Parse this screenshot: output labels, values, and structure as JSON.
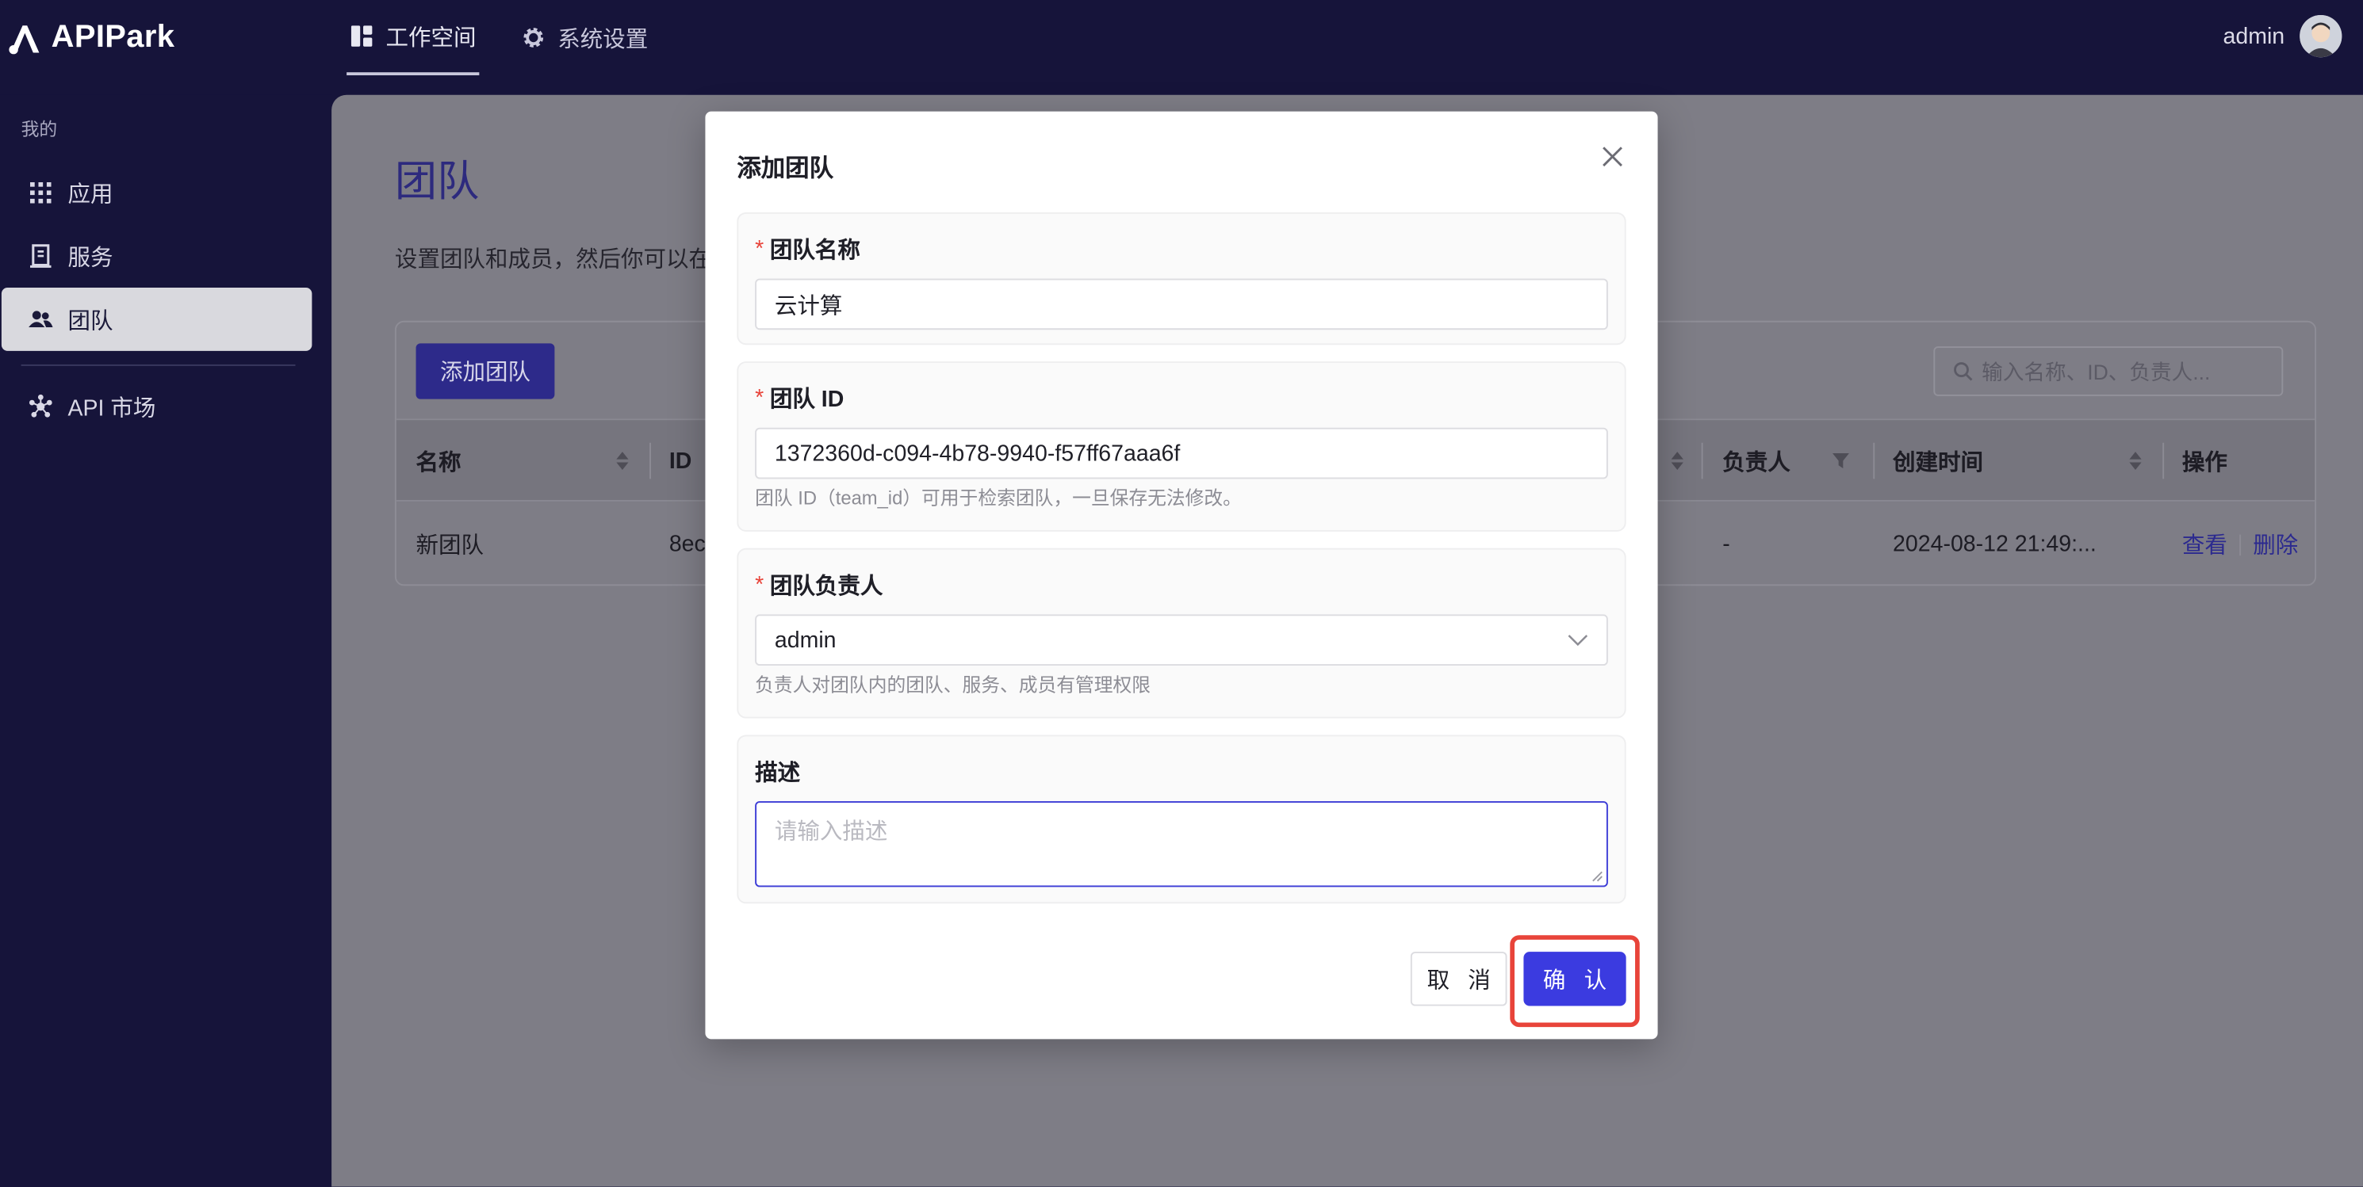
{
  "brand": {
    "name": "APIPark"
  },
  "nav": {
    "items": [
      {
        "label": "工作空间",
        "icon": "dashboard-icon",
        "active": true
      },
      {
        "label": "系统设置",
        "icon": "gear-icon",
        "active": false
      }
    ]
  },
  "user": {
    "name": "admin",
    "avatar": "avatar-icon"
  },
  "sidebar": {
    "section": "我的",
    "items": [
      {
        "label": "应用",
        "icon": "grid-icon"
      },
      {
        "label": "服务",
        "icon": "building-icon"
      },
      {
        "label": "团队",
        "icon": "team-icon",
        "active": true
      },
      {
        "label": "API 市场",
        "icon": "network-icon"
      }
    ]
  },
  "page": {
    "title": "团队",
    "description": "设置团队和成员，然后你可以在",
    "add_button": "添加团队",
    "search_placeholder": "输入名称、ID、负责人...",
    "table": {
      "columns": [
        "名称",
        "ID",
        "负责人",
        "创建时间",
        "操作"
      ],
      "rows": [
        {
          "name": "新团队",
          "id": "8ec",
          "owner": "-",
          "created": "2024-08-12 21:49:...",
          "actions": [
            "查看",
            "删除"
          ]
        }
      ]
    }
  },
  "modal": {
    "title": "添加团队",
    "fields": {
      "name": {
        "label": "团队名称",
        "value": "云计算"
      },
      "id": {
        "label": "团队 ID",
        "value": "1372360d-c094-4b78-9940-f57ff67aaa6f",
        "hint": "团队 ID（team_id）可用于检索团队，一旦保存无法修改。"
      },
      "owner": {
        "label": "团队负责人",
        "value": "admin",
        "hint": "负责人对团队内的团队、服务、成员有管理权限"
      },
      "description": {
        "label": "描述",
        "placeholder": "请输入描述"
      }
    },
    "cancel_label": "取 消",
    "confirm_label": "确 认"
  },
  "colors": {
    "background": "#16143a",
    "primary": "#3b3be0",
    "highlight": "#e8443a"
  }
}
